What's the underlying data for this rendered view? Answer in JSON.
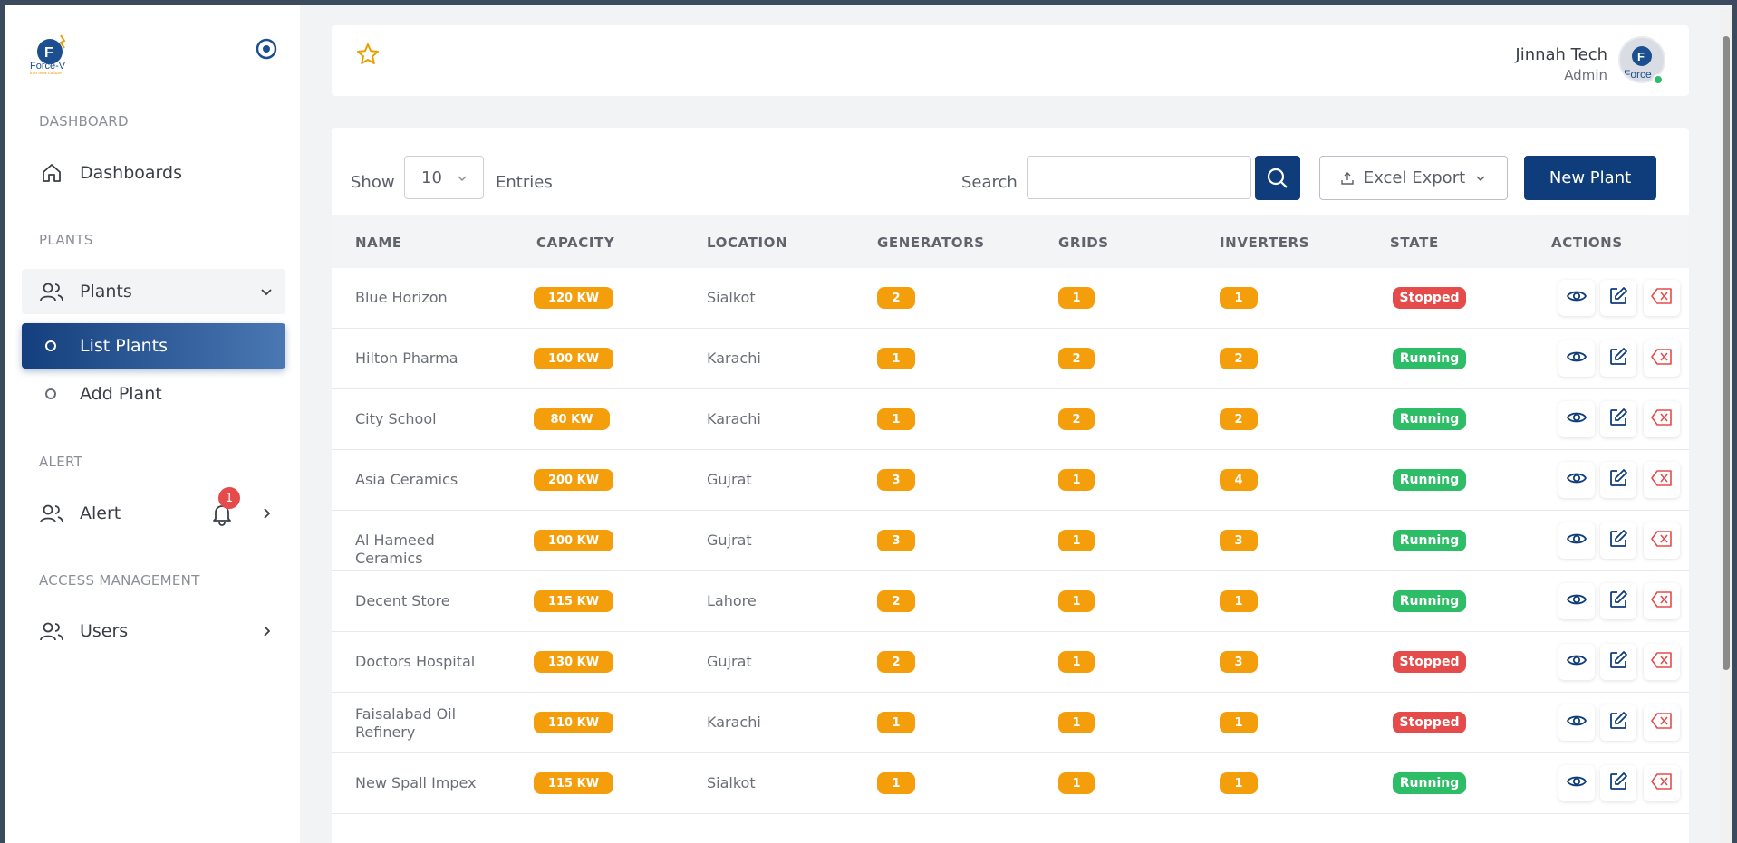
{
  "brand": {
    "logo_text": "Force-V",
    "logo_sub": "into new culture"
  },
  "sidebar": {
    "sections": {
      "dashboard": "DASHBOARD",
      "plants": "PLANTS",
      "alert": "ALERT",
      "access": "ACCESS MANAGEMENT"
    },
    "items": {
      "dashboards": "Dashboards",
      "plants": "Plants",
      "list_plants": "List Plants",
      "add_plant": "Add Plant",
      "alert": "Alert",
      "alert_count": "1",
      "users": "Users"
    }
  },
  "header": {
    "user_name": "Jinnah Tech",
    "user_role": "Admin",
    "avatar_text": "Force"
  },
  "toolbar": {
    "show_label": "Show",
    "page_size": "10",
    "entries_label": "Entries",
    "search_label": "Search",
    "search_value": "",
    "excel_label": "Excel Export",
    "new_label": "New Plant"
  },
  "table": {
    "columns": [
      "NAME",
      "CAPACITY",
      "LOCATION",
      "GENERATORS",
      "GRIDS",
      "INVERTERS",
      "STATE",
      "ACTIONS"
    ],
    "rows": [
      {
        "name": "Blue Horizon",
        "capacity": "120 KW",
        "location": "Sialkot",
        "generators": "2",
        "grids": "1",
        "inverters": "1",
        "state": "Stopped"
      },
      {
        "name": "Hilton Pharma",
        "capacity": "100 KW",
        "location": "Karachi",
        "generators": "1",
        "grids": "2",
        "inverters": "2",
        "state": "Running"
      },
      {
        "name": "City School",
        "capacity": "80 KW",
        "location": "Karachi",
        "generators": "1",
        "grids": "2",
        "inverters": "2",
        "state": "Running"
      },
      {
        "name": "Asia Ceramics",
        "capacity": "200 KW",
        "location": "Gujrat",
        "generators": "3",
        "grids": "1",
        "inverters": "4",
        "state": "Running"
      },
      {
        "name": "Al Hameed Ceramics",
        "capacity": "100 KW",
        "location": "Gujrat",
        "generators": "3",
        "grids": "1",
        "inverters": "3",
        "state": "Running"
      },
      {
        "name": "Decent Store",
        "capacity": "115 KW",
        "location": "Lahore",
        "generators": "2",
        "grids": "1",
        "inverters": "1",
        "state": "Running"
      },
      {
        "name": "Doctors Hospital",
        "capacity": "130 KW",
        "location": "Gujrat",
        "generators": "2",
        "grids": "1",
        "inverters": "3",
        "state": "Stopped"
      },
      {
        "name": "Faisalabad Oil Refinery",
        "capacity": "110 KW",
        "location": "Karachi",
        "generators": "1",
        "grids": "1",
        "inverters": "1",
        "state": "Stopped"
      },
      {
        "name": "New Spall Impex",
        "capacity": "115 KW",
        "location": "Sialkot",
        "generators": "1",
        "grids": "1",
        "inverters": "1",
        "state": "Running"
      }
    ]
  },
  "colors": {
    "primary": "#0f3d7b",
    "accent": "#f59e0b",
    "running": "#2dbd66",
    "stopped": "#e54b4b"
  },
  "icons": {
    "view": "eye-icon",
    "edit": "edit-icon",
    "delete": "delete-icon"
  }
}
